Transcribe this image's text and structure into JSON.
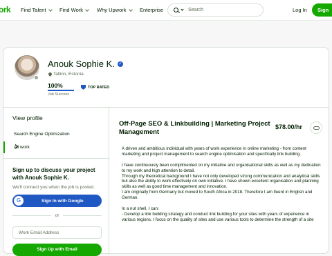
{
  "header": {
    "logo": "ork",
    "nav": [
      "Find Talent",
      "Find Work",
      "Why Upwork",
      "Enterprise"
    ],
    "search_placeholder": "Search",
    "login": "Log In",
    "signup": "Sign"
  },
  "profile": {
    "name": "Anouk Sophie K.",
    "location": "Tallinn, Estonia",
    "job_success": "100%",
    "job_success_fraction": 1.0,
    "job_success_label": "Job Success",
    "badge": "TOP RATED"
  },
  "sidebar": {
    "title": "View profile",
    "items": [
      "Search Engine Optimization",
      "All work"
    ],
    "cta_title": "Sign up to discuss your project with Anouk Sophie K.",
    "cta_sub": "We'll connect you when the job is posted.",
    "google_button": "Sign In with Google",
    "google_glyph": "G",
    "or": "or",
    "email_placeholder": "Work Email Address",
    "email_button": "Sign Up with Email"
  },
  "main": {
    "title": "Off-Page SEO & Linkbuilding | Marketing Project Management",
    "rate": "$78.00/hr",
    "paragraphs": [
      "A driven and ambitious individual with years of work experience in online marketing - from content marketing and project management to search engine optimisation and specifically link building.",
      "I have continuously been complimented on my initiative and organisational skills as well as my dedication to my work and high attention to detail.",
      "Through my theoretical background I have not only developed strong communication and analytical skills but also the ability to work effectively on own initiative. I have shown excellent organisation and planning skills as well as good time management and innovation.",
      "I am originally from Germany but moved to South Africa in 2018. Therefore I am fluent in English and German.",
      "In a nut shell, I can:",
      "- Develop a link building strategy and conduct link building for your sites with years of experience in various regions. I focus on the quality of sites and use various tools to determine the strength of a site"
    ]
  },
  "colors": {
    "brand_green": "#14a800",
    "accent_blue": "#1f57c3",
    "text": "#001e00",
    "muted": "#5e6d55"
  }
}
